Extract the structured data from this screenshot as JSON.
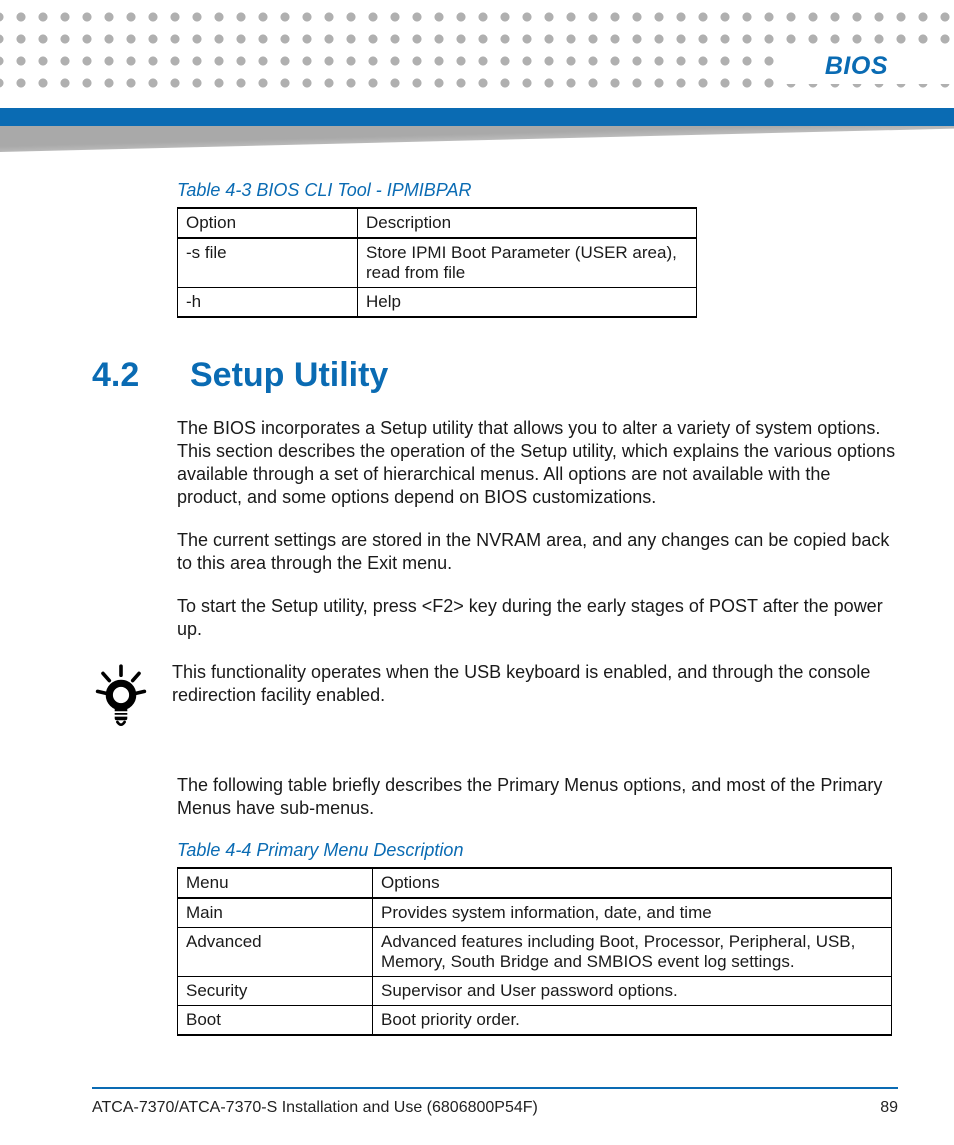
{
  "header": {
    "chapter_title": "BIOS"
  },
  "table1": {
    "caption": "Table 4-3 BIOS CLI Tool - IPMIBPAR",
    "header": {
      "c1": "Option",
      "c2": "Description"
    },
    "rows": [
      {
        "c1": "-s file",
        "c2": "Store IPMI Boot Parameter (USER area), read from file"
      },
      {
        "c1": "-h",
        "c2": "Help"
      }
    ]
  },
  "section": {
    "number": "4.2",
    "title": "Setup Utility",
    "p1": "The BIOS incorporates a Setup utility that allows you to alter a variety of system options. This section describes the operation of the Setup utility, which explains the various options available through a set of hierarchical menus. All options are not available with the product, and some options depend on BIOS customizations.",
    "p2": "The current settings are stored in the NVRAM area, and any changes can be copied back to this area through the Exit menu.",
    "p3": "To start the Setup utility, press <F2> key during the early stages of POST after the power up.",
    "tip": "This functionality operates when the USB keyboard is enabled, and through the console redirection facility enabled.",
    "p4": "The following table briefly describes the Primary Menus options, and most of the Primary Menus have sub-menus."
  },
  "table2": {
    "caption": "Table 4-4 Primary Menu Description",
    "header": {
      "c1": "Menu",
      "c2": "Options"
    },
    "rows": [
      {
        "c1": "Main",
        "c2": "Provides system information, date, and time"
      },
      {
        "c1": "Advanced",
        "c2": "Advanced features including Boot, Processor, Peripheral, USB, Memory, South Bridge and SMBIOS event log settings."
      },
      {
        "c1": "Security",
        "c2": "Supervisor and User password options."
      },
      {
        "c1": "Boot",
        "c2": "Boot priority order."
      }
    ]
  },
  "footer": {
    "doc": "ATCA-7370/ATCA-7370-S Installation and Use (6806800P54F)",
    "page": "89"
  }
}
